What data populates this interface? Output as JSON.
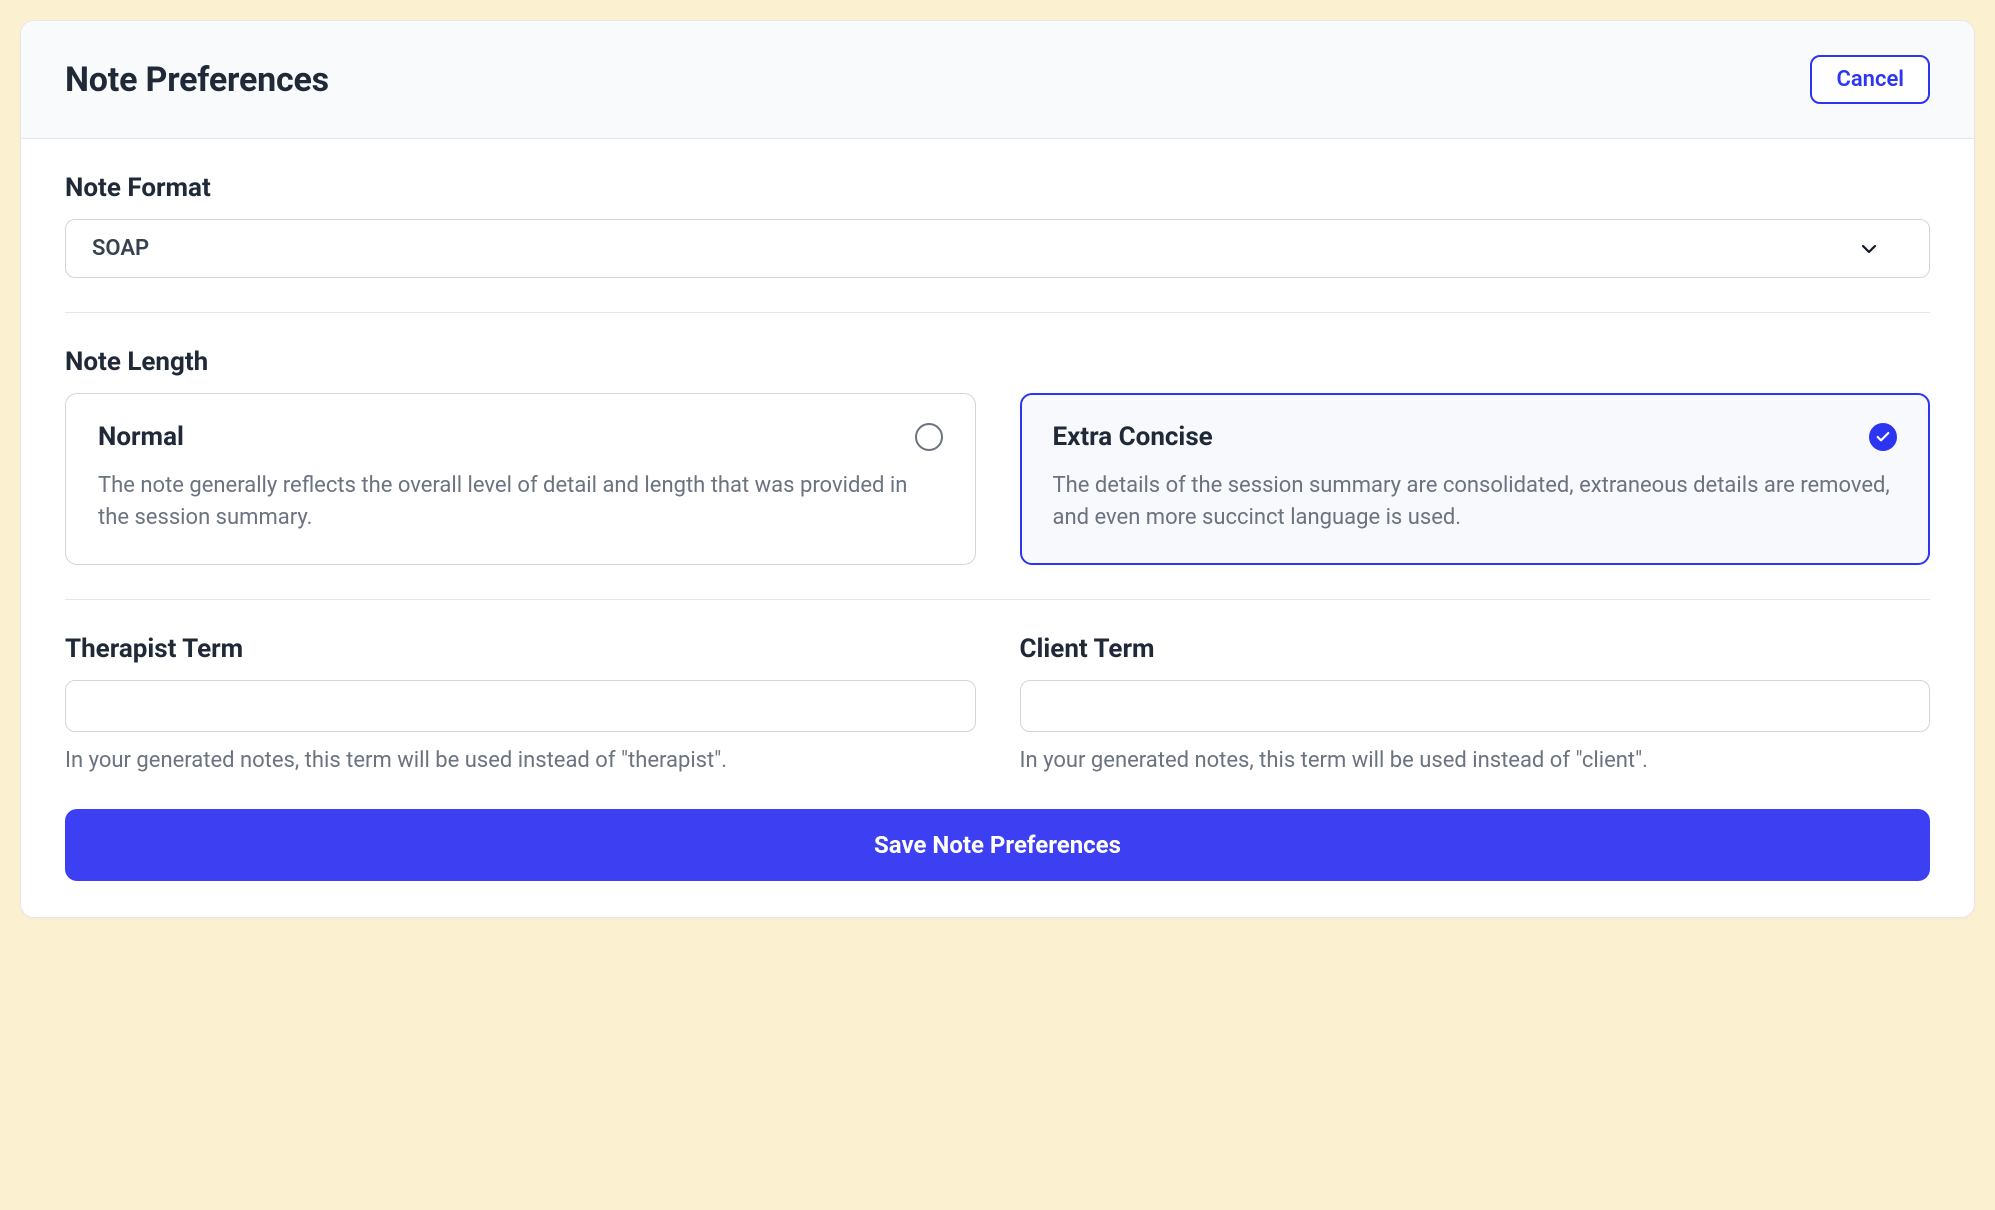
{
  "header": {
    "title": "Note Preferences",
    "cancel_label": "Cancel"
  },
  "note_format": {
    "label": "Note Format",
    "selected": "SOAP"
  },
  "note_length": {
    "label": "Note Length",
    "options": [
      {
        "title": "Normal",
        "description": "The note generally reflects the overall level of detail and length that was provided in the session summary.",
        "selected": false
      },
      {
        "title": "Extra Concise",
        "description": "The details of the session summary are consolidated, extraneous details are removed, and even more succinct language is used.",
        "selected": true
      }
    ]
  },
  "therapist_term": {
    "label": "Therapist Term",
    "value": "",
    "helper": "In your generated notes, this term will be used instead of \"therapist\"."
  },
  "client_term": {
    "label": "Client Term",
    "value": "",
    "helper": "In your generated notes, this term will be used instead of \"client\"."
  },
  "save_button_label": "Save Note Preferences",
  "colors": {
    "accent": "#2c36f2",
    "primary_button": "#3c3ff2"
  }
}
